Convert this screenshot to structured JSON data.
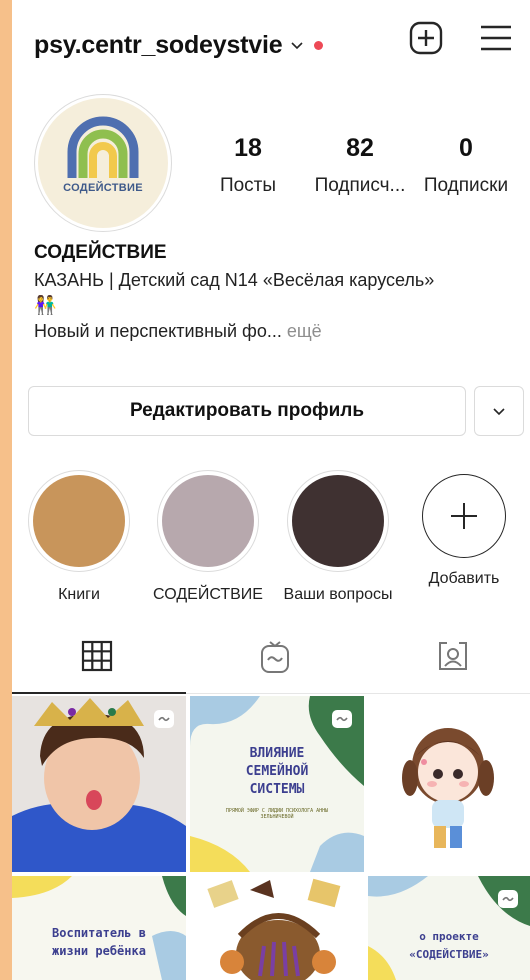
{
  "header": {
    "username": "psy.centr_sodeystvie",
    "icons": [
      "chevron-down-icon",
      "new-post-icon",
      "menu-icon"
    ]
  },
  "profile": {
    "avatar_text": "СОДЕЙСТВИЕ",
    "stats": [
      {
        "value": "18",
        "label": "Посты"
      },
      {
        "value": "82",
        "label": "Подписч..."
      },
      {
        "value": "0",
        "label": "Подписки"
      }
    ],
    "bio": {
      "name": "СОДЕЙСТВИЕ",
      "line1": "КАЗАНЬ | Детский сад N14 «Весёлая карусель»",
      "emoji": "👫",
      "line2": "Новый и перспективный фо...",
      "more": " ещё"
    }
  },
  "buttons": {
    "edit_profile": "Редактировать профиль"
  },
  "highlights": [
    {
      "label": "Книги",
      "color": "#c8955b"
    },
    {
      "label": "СОДЕЙСТВИЕ",
      "color": "#b7a8ad"
    },
    {
      "label": "Ваши вопросы",
      "color": "#3f3131"
    },
    {
      "label": "Добавить"
    }
  ],
  "tabs": [
    "grid-icon",
    "reels-icon",
    "tagged-icon"
  ],
  "posts": [
    {
      "type": "photo"
    },
    {
      "type": "card",
      "text_lines": [
        "ВЛИЯНИЕ",
        "СЕМЕЙНОЙ",
        "СИСТЕМЫ"
      ],
      "subtitle": "ПРЯМОЙ ЭФИР С ЛИДИИ ПСИХОЛОГА АННЫ ЗЕЛЬНИЧЕВОЙ"
    },
    {
      "type": "illustration"
    },
    {
      "type": "card",
      "text_lines": [
        "Воспитатель в",
        "жизни ребёнка"
      ]
    },
    {
      "type": "illustration"
    },
    {
      "type": "card",
      "text_lines": [
        "о проекте",
        "«СОДЕЙСТВИЕ»"
      ]
    }
  ]
}
